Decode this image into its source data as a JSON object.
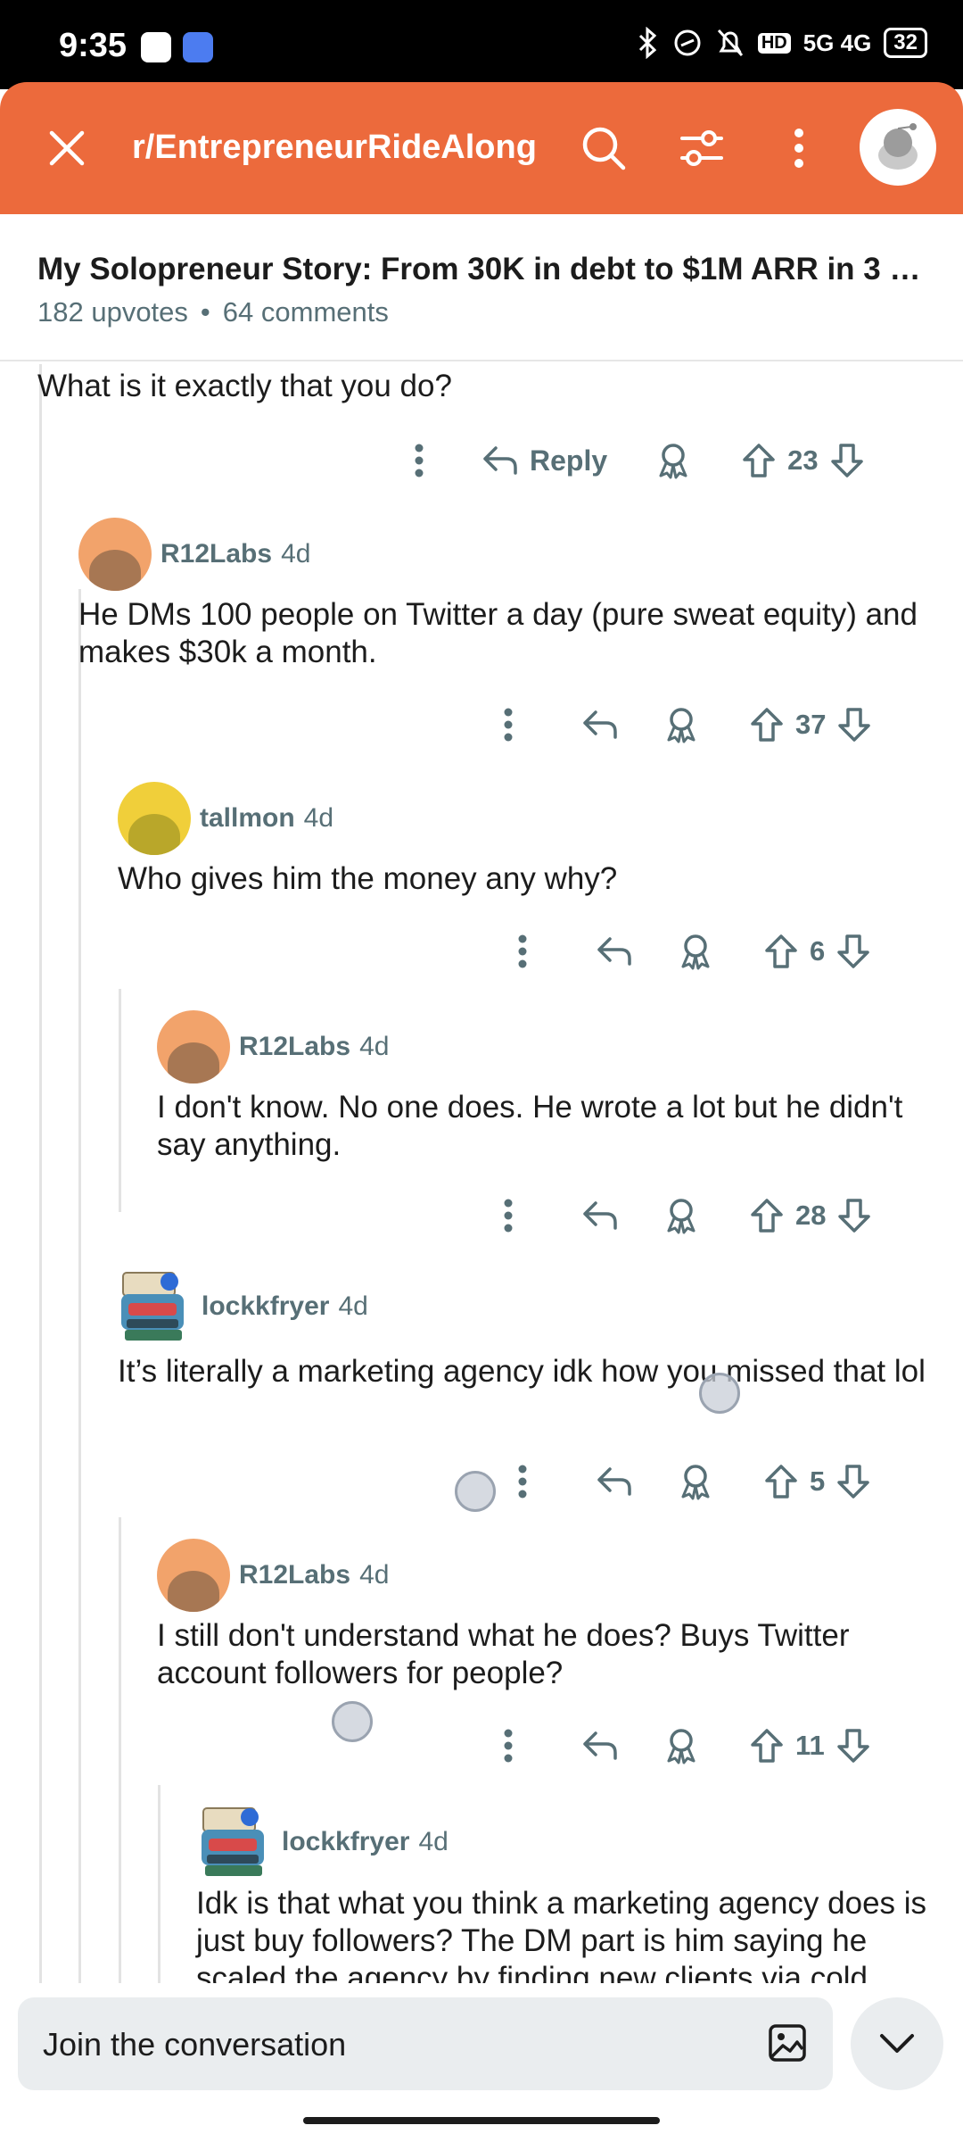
{
  "status_bar": {
    "time": "9:35",
    "network": "5G 4G",
    "battery": "32"
  },
  "header": {
    "subreddit": "r/EntrepreneurRideAlong"
  },
  "post": {
    "title": "My Solopreneur Story: From 30K in debt to $1M ARR in 3 ye...",
    "upvotes": "182 upvotes",
    "separator": "•",
    "comments": "64 comments"
  },
  "comments": [
    {
      "user": "",
      "time": "",
      "text": "What is it exactly that you do?",
      "votes": "23",
      "reply_label": "Reply"
    },
    {
      "user": "R12Labs",
      "time": "4d",
      "text": "He DMs 100 people on Twitter a day (pure sweat equity) and makes $30k a month.",
      "votes": "37"
    },
    {
      "user": "tallmon",
      "time": "4d",
      "text": "Who gives him the money any why?",
      "votes": "6"
    },
    {
      "user": "R12Labs",
      "time": "4d",
      "text": "I don't know. No one does. He wrote a lot but he didn't say anything.",
      "votes": "28"
    },
    {
      "user": "lockkfryer",
      "time": "4d",
      "text": "It’s literally a marketing agency idk how you missed that lol",
      "votes": "5"
    },
    {
      "user": "R12Labs",
      "time": "4d",
      "text": "I still don't understand what he does? Buys Twitter account followers for people?",
      "votes": "11"
    },
    {
      "user": "lockkfryer",
      "time": "4d",
      "text": "Idk is that what you think a marketing agency does is just buy followers? The DM part is him saying he scaled the agency by finding new clients via cold"
    }
  ],
  "composer": {
    "placeholder": "Join the conversation"
  },
  "colors": {
    "accent": "#ec6a3c",
    "meta": "#576f76",
    "thread": "#e3e3e3"
  }
}
